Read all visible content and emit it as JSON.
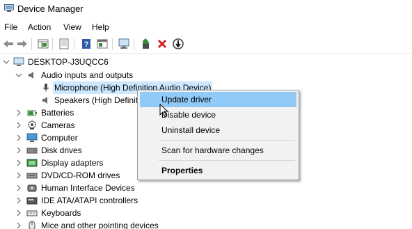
{
  "window": {
    "title": "Device Manager"
  },
  "menu": [
    "File",
    "Action",
    "View",
    "Help"
  ],
  "toolbar": {
    "buttons": [
      "back-icon",
      "forward-icon",
      "properties-grid-icon",
      "properties-sheet-icon",
      "help-icon",
      "console-icon",
      "monitor-scan-icon",
      "update-driver-icon",
      "uninstall-icon",
      "disable-icon"
    ],
    "accent_red": "#d81e1e",
    "accent_green": "#2d8a2d"
  },
  "tree": {
    "root": "DESKTOP-J3UQCC6",
    "audio": {
      "label": "Audio inputs and outputs",
      "children": [
        "Microphone (High Definition Audio Device)",
        "Speakers (High Definition Audio Device)"
      ],
      "selected": "Microphone (High Definition Audio Device)"
    },
    "categories": [
      "Batteries",
      "Cameras",
      "Computer",
      "Disk drives",
      "Display adapters",
      "DVD/CD-ROM drives",
      "Human Interface Devices",
      "IDE ATA/ATAPI controllers",
      "Keyboards",
      "Mice and other pointing devices"
    ],
    "speakers_visible": "Speakers (High Definit"
  },
  "context_menu": {
    "update": "Update driver",
    "disable": "Disable device",
    "uninstall": "Uninstall device",
    "scan": "Scan for hardware changes",
    "properties": "Properties",
    "highlight_color": "#91c9f7"
  }
}
